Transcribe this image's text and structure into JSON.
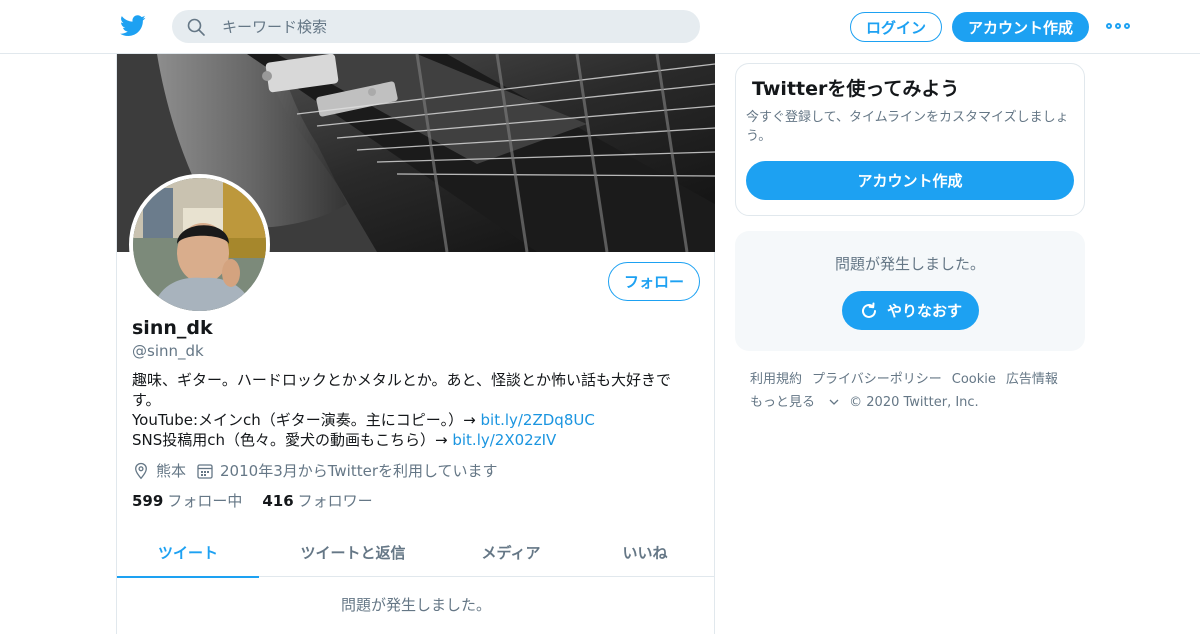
{
  "header": {
    "search_placeholder": "キーワード検索",
    "login_label": "ログイン",
    "signup_label": "アカウント作成"
  },
  "profile": {
    "display_name": "sinn_dk",
    "handle": "@sinn_dk",
    "follow_label": "フォロー",
    "bio": {
      "line1": "趣味、ギター。ハードロックとかメタルとか。あと、怪談とか怖い話も大好きで",
      "line2": "す。",
      "line3_text": "YouTube:メインch（ギター演奏。主にコピー。）→ ",
      "line3_link": "bit.ly/2ZDq8UC",
      "line4_text": "SNS投稿用ch（色々。愛犬の動画もこちら）→ ",
      "line4_link": "bit.ly/2X02zIV"
    },
    "location": "熊本",
    "joined": "2010年3月からTwitterを利用しています",
    "following_count": "599",
    "following_label": "フォロー中",
    "followers_count": "416",
    "followers_label": "フォロワー"
  },
  "tabs": [
    {
      "label": "ツイート",
      "active": true
    },
    {
      "label": "ツイートと返信",
      "active": false
    },
    {
      "label": "メディア",
      "active": false
    },
    {
      "label": "いいね",
      "active": false
    }
  ],
  "main_error": "問題が発生しました。",
  "signup_card": {
    "title": "Twitterを使ってみよう",
    "description": "今すぐ登録して、タイムラインをカスタマイズしましょう。",
    "button_label": "アカウント作成"
  },
  "error_card": {
    "message": "問題が発生しました。",
    "retry_label": "やりなおす"
  },
  "footer": {
    "links": [
      "利用規約",
      "プライバシーポリシー",
      "Cookie",
      "広告情報"
    ],
    "more_label": "もっと見る",
    "copyright": "© 2020 Twitter, Inc."
  },
  "colors": {
    "accent": "#1da1f2",
    "text": "#14171a",
    "muted": "#657786",
    "border": "#e1e8ed"
  }
}
